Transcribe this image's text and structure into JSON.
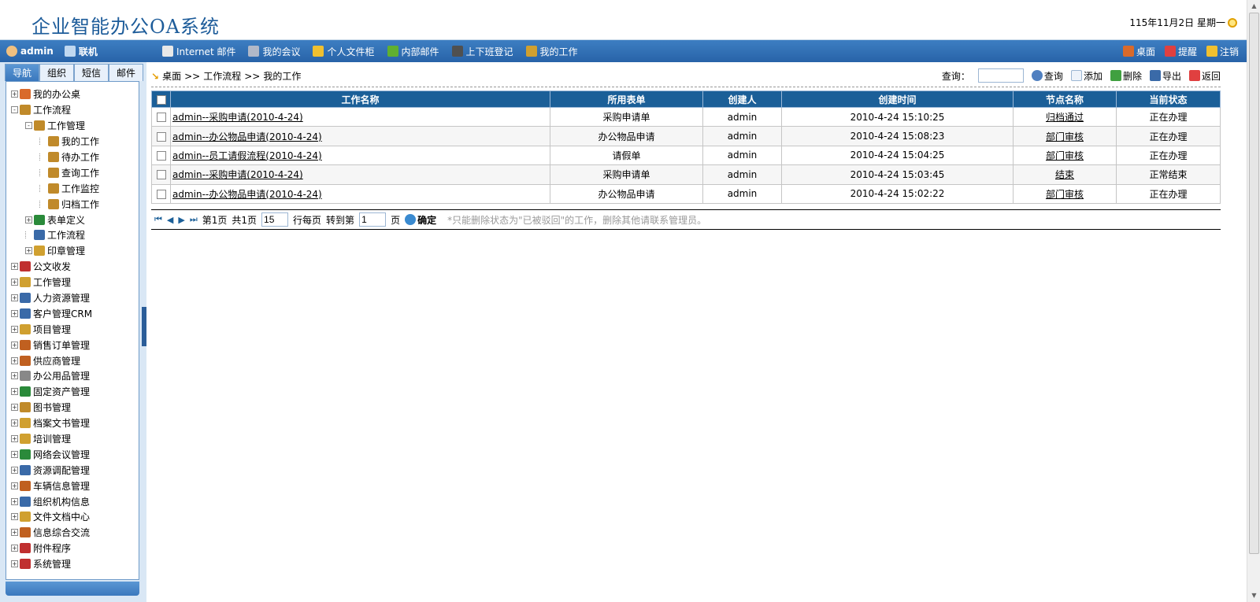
{
  "header": {
    "title": "企业智能办公OA系统",
    "date": "115年11月2日 星期一"
  },
  "topbar": {
    "user": "admin",
    "status": "联机",
    "menu": [
      "Internet 邮件",
      "我的会议",
      "个人文件柜",
      "内部邮件",
      "上下班登记",
      "我的工作"
    ],
    "right": [
      "桌面",
      "提醒",
      "注销"
    ]
  },
  "left": {
    "tabs": [
      "导航",
      "组织",
      "短信",
      "邮件"
    ],
    "tree": [
      {
        "label": "我的办公桌",
        "level": 0,
        "pm": "+",
        "color": "#d96a2b"
      },
      {
        "label": "工作流程",
        "level": 0,
        "pm": "-",
        "color": "#c08a2a"
      },
      {
        "label": "工作管理",
        "level": 1,
        "pm": "-",
        "color": "#c08a2a"
      },
      {
        "label": "我的工作",
        "level": 2,
        "pm": "",
        "color": "#c08a2a"
      },
      {
        "label": "待办工作",
        "level": 2,
        "pm": "",
        "color": "#c08a2a"
      },
      {
        "label": "查询工作",
        "level": 2,
        "pm": "",
        "color": "#c08a2a"
      },
      {
        "label": "工作监控",
        "level": 2,
        "pm": "",
        "color": "#c08a2a"
      },
      {
        "label": "归档工作",
        "level": 2,
        "pm": "",
        "color": "#c08a2a"
      },
      {
        "label": "表单定义",
        "level": 1,
        "pm": "+",
        "color": "#2a8a3a"
      },
      {
        "label": "工作流程",
        "level": 1,
        "pm": "",
        "color": "#3a6aa8"
      },
      {
        "label": "印章管理",
        "level": 1,
        "pm": "+",
        "color": "#d0a030"
      },
      {
        "label": "公文收发",
        "level": 0,
        "pm": "+",
        "color": "#c03030"
      },
      {
        "label": "工作管理",
        "level": 0,
        "pm": "+",
        "color": "#d0a030"
      },
      {
        "label": "人力资源管理",
        "level": 0,
        "pm": "+",
        "color": "#3a6aa8"
      },
      {
        "label": "客户管理CRM",
        "level": 0,
        "pm": "+",
        "color": "#3a6aa8"
      },
      {
        "label": "项目管理",
        "level": 0,
        "pm": "+",
        "color": "#d0a030"
      },
      {
        "label": "销售订单管理",
        "level": 0,
        "pm": "+",
        "color": "#c06020"
      },
      {
        "label": "供应商管理",
        "level": 0,
        "pm": "+",
        "color": "#c06020"
      },
      {
        "label": "办公用品管理",
        "level": 0,
        "pm": "+",
        "color": "#888888"
      },
      {
        "label": "固定资产管理",
        "level": 0,
        "pm": "+",
        "color": "#2a8a3a"
      },
      {
        "label": "图书管理",
        "level": 0,
        "pm": "+",
        "color": "#c08a2a"
      },
      {
        "label": "档案文书管理",
        "level": 0,
        "pm": "+",
        "color": "#d0a030"
      },
      {
        "label": "培训管理",
        "level": 0,
        "pm": "+",
        "color": "#d0a030"
      },
      {
        "label": "网络会议管理",
        "level": 0,
        "pm": "+",
        "color": "#2a8a3a"
      },
      {
        "label": "资源调配管理",
        "level": 0,
        "pm": "+",
        "color": "#3a6aa8"
      },
      {
        "label": "车辆信息管理",
        "level": 0,
        "pm": "+",
        "color": "#c06020"
      },
      {
        "label": "组织机构信息",
        "level": 0,
        "pm": "+",
        "color": "#3a6aa8"
      },
      {
        "label": "文件文档中心",
        "level": 0,
        "pm": "+",
        "color": "#d0a030"
      },
      {
        "label": "信息综合交流",
        "level": 0,
        "pm": "+",
        "color": "#c06020"
      },
      {
        "label": "附件程序",
        "level": 0,
        "pm": "+",
        "color": "#c03030"
      },
      {
        "label": "系统管理",
        "level": 0,
        "pm": "+",
        "color": "#c03030"
      }
    ]
  },
  "main": {
    "breadcrumb": [
      "桌面",
      ">>",
      "工作流程",
      ">>",
      "我的工作"
    ],
    "toolbar": {
      "query_label": "查询：",
      "query_btn": "查询",
      "add": "添加",
      "delete": "删除",
      "export": "导出",
      "back": "返回"
    },
    "table": {
      "headers": [
        "工作名称",
        "所用表单",
        "创建人",
        "创建时间",
        "节点名称",
        "当前状态"
      ],
      "rows": [
        [
          "admin--采购申请(2010-4-24)",
          "采购申请单",
          "admin",
          "2010-4-24 15:10:25",
          "归档通过",
          "正在办理"
        ],
        [
          "admin--办公物品申请(2010-4-24)",
          "办公物品申请",
          "admin",
          "2010-4-24 15:08:23",
          "部门审核",
          "正在办理"
        ],
        [
          "admin--员工请假流程(2010-4-24)",
          "请假单",
          "admin",
          "2010-4-24 15:04:25",
          "部门审核",
          "正在办理"
        ],
        [
          "admin--采购申请(2010-4-24)",
          "采购申请单",
          "admin",
          "2010-4-24 15:03:45",
          "结束",
          "正常结束"
        ],
        [
          "admin--办公物品申请(2010-4-24)",
          "办公物品申请",
          "admin",
          "2010-4-24 15:02:22",
          "部门审核",
          "正在办理"
        ]
      ]
    },
    "pager": {
      "page_info": "第1页",
      "total": "共1页",
      "per_page_value": "15",
      "per_page_label": "行每页",
      "goto_label": "转到第",
      "goto_value": "1",
      "page_suffix": "页",
      "confirm": "确定",
      "note": "*只能删除状态为\"已被驳回\"的工作，删除其他请联系管理员。"
    }
  }
}
